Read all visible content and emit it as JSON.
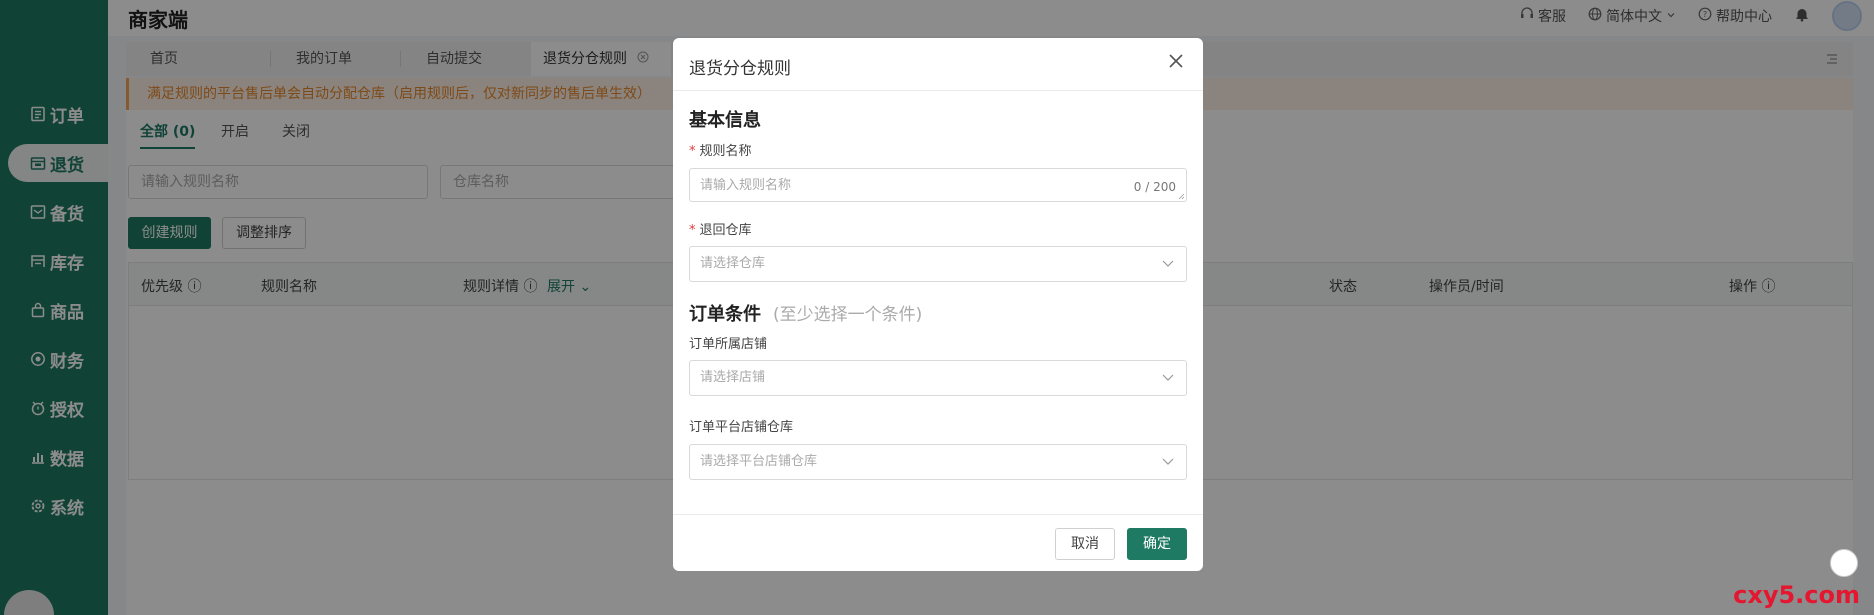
{
  "header": {
    "brand": "商家端",
    "service": "客服",
    "language": "简体中文",
    "help": "帮助中心"
  },
  "sidebar": {
    "items": [
      {
        "label": "订单",
        "icon": "order-icon"
      },
      {
        "label": "退货",
        "icon": "return-icon",
        "active": true
      },
      {
        "label": "备货",
        "icon": "stock-prep-icon"
      },
      {
        "label": "库存",
        "icon": "inventory-icon"
      },
      {
        "label": "商品",
        "icon": "product-icon"
      },
      {
        "label": "财务",
        "icon": "finance-icon"
      },
      {
        "label": "授权",
        "icon": "auth-icon"
      },
      {
        "label": "数据",
        "icon": "data-icon"
      },
      {
        "label": "系统",
        "icon": "system-icon"
      }
    ]
  },
  "tabs": [
    "首页",
    "我的订单",
    "自动提交",
    "退货分仓规则"
  ],
  "notice": "满足规则的平台售后单会自动分配仓库（启用规则后，仅对新同步的售后单生效）",
  "filters": {
    "all": "全部 (0)",
    "on": "开启",
    "off": "关闭",
    "rule_name_placeholder": "请输入规则名称",
    "warehouse_placeholder": "仓库名称"
  },
  "actions": {
    "create": "创建规则",
    "reorder": "调整排序"
  },
  "table": {
    "priority": "优先级",
    "rule_name": "规则名称",
    "rule_detail": "规则详情",
    "expand": "展开",
    "status": "状态",
    "operator_time": "操作员/时间",
    "operation": "操作"
  },
  "modal": {
    "title": "退货分仓规则",
    "basic_info": "基本信息",
    "rule_name_label": "规则名称",
    "rule_name_placeholder": "请输入规则名称",
    "rule_name_counter": "0 / 200",
    "return_warehouse_label": "退回仓库",
    "return_warehouse_placeholder": "请选择仓库",
    "order_conditions": "订单条件",
    "order_conditions_hint": "(至少选择一个条件)",
    "shop_label": "订单所属店铺",
    "shop_placeholder": "请选择店铺",
    "platform_wh_label": "订单平台店铺仓库",
    "platform_wh_placeholder": "请选择平台店铺仓库",
    "cancel": "取消",
    "confirm": "确定"
  },
  "watermark": "cxy5.com",
  "colors": {
    "brand": "#1e7a63",
    "notice": "#e5872a",
    "required": "#e53935"
  }
}
